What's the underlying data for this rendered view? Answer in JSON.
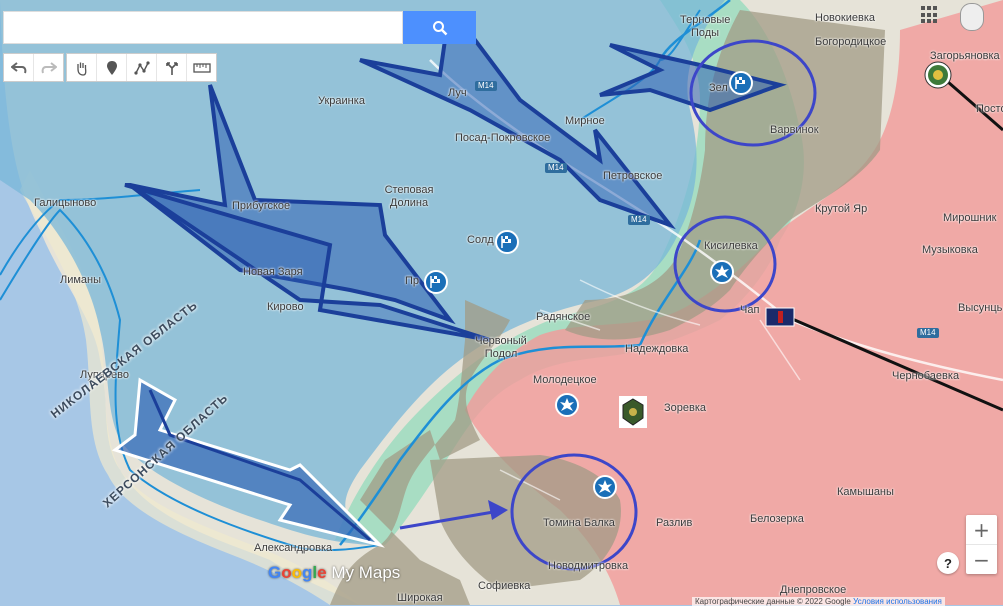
{
  "search": {
    "placeholder": ""
  },
  "toolbar": {
    "undo_icon": "undo-icon",
    "redo_icon": "redo-icon",
    "pan_icon": "hand-icon",
    "marker_icon": "marker-icon",
    "line_icon": "draw-line-icon",
    "route_icon": "directions-icon",
    "measure_icon": "ruler-icon"
  },
  "map": {
    "places": [
      {
        "name": "Терновые Поды"
      },
      {
        "name": "Новокиевка"
      },
      {
        "name": "Богородицкое"
      },
      {
        "name": "Загорьяновка"
      },
      {
        "name": "Зел"
      },
      {
        "name": "Варвинок"
      },
      {
        "name": "Украинка"
      },
      {
        "name": "Луч"
      },
      {
        "name": "Посад-Покровское"
      },
      {
        "name": "Мирное"
      },
      {
        "name": "Петровское"
      },
      {
        "name": "Крутой Яр"
      },
      {
        "name": "Мирошник"
      },
      {
        "name": "Музыковка"
      },
      {
        "name": "Галицыново"
      },
      {
        "name": "Прибугское"
      },
      {
        "name": "Степовая Долина"
      },
      {
        "name": "Солд"
      },
      {
        "name": "Кисилевка"
      },
      {
        "name": "Высунць"
      },
      {
        "name": "Лиманы"
      },
      {
        "name": "Новая Заря"
      },
      {
        "name": "Пр"
      },
      {
        "name": "Кирово"
      },
      {
        "name": "Радянское"
      },
      {
        "name": "Чап"
      },
      {
        "name": "Червоный Подол"
      },
      {
        "name": "Надеждовка"
      },
      {
        "name": "Чернобаевка"
      },
      {
        "name": "Лупарево"
      },
      {
        "name": "Молодецкое"
      },
      {
        "name": "Зоревка"
      },
      {
        "name": "Камышаны"
      },
      {
        "name": "Томина Балка"
      },
      {
        "name": "Разлив"
      },
      {
        "name": "Белозерка"
      },
      {
        "name": "Александровка"
      },
      {
        "name": "Новодмитровка"
      },
      {
        "name": "Софиевка"
      },
      {
        "name": "Широкая"
      },
      {
        "name": "Днепровское"
      },
      {
        "name": "Посто"
      }
    ],
    "roads": [
      "M14",
      "M14",
      "M14",
      "M14"
    ],
    "oblast_labels": [
      "НИКОЛАЕВСКАЯ ОБЛАСТЬ",
      "ХЕРСОНСКАЯ ОБЛАСТЬ"
    ],
    "colors": {
      "water": "#a7c7e6",
      "land": "#e6e3d8",
      "forest": "#cfe3c4",
      "ukraine_zone": "#78b7d8",
      "russia_zone": "#f29a9a",
      "grey_zone": "#9a9a8a",
      "border_line": "#1e8fd6",
      "arrow": "#1b3f9a",
      "circle": "#3d46c9",
      "front": "#7ed9b5"
    }
  },
  "zoom": {
    "in_label": "+",
    "out_label": "−"
  },
  "help_label": "?",
  "brand": {
    "google": [
      "G",
      "o",
      "o",
      "g",
      "l",
      "e"
    ],
    "product": " My Maps"
  },
  "footer": {
    "data_text": "Картографические данные © 2022 Google",
    "terms_link": "Условия использования"
  }
}
